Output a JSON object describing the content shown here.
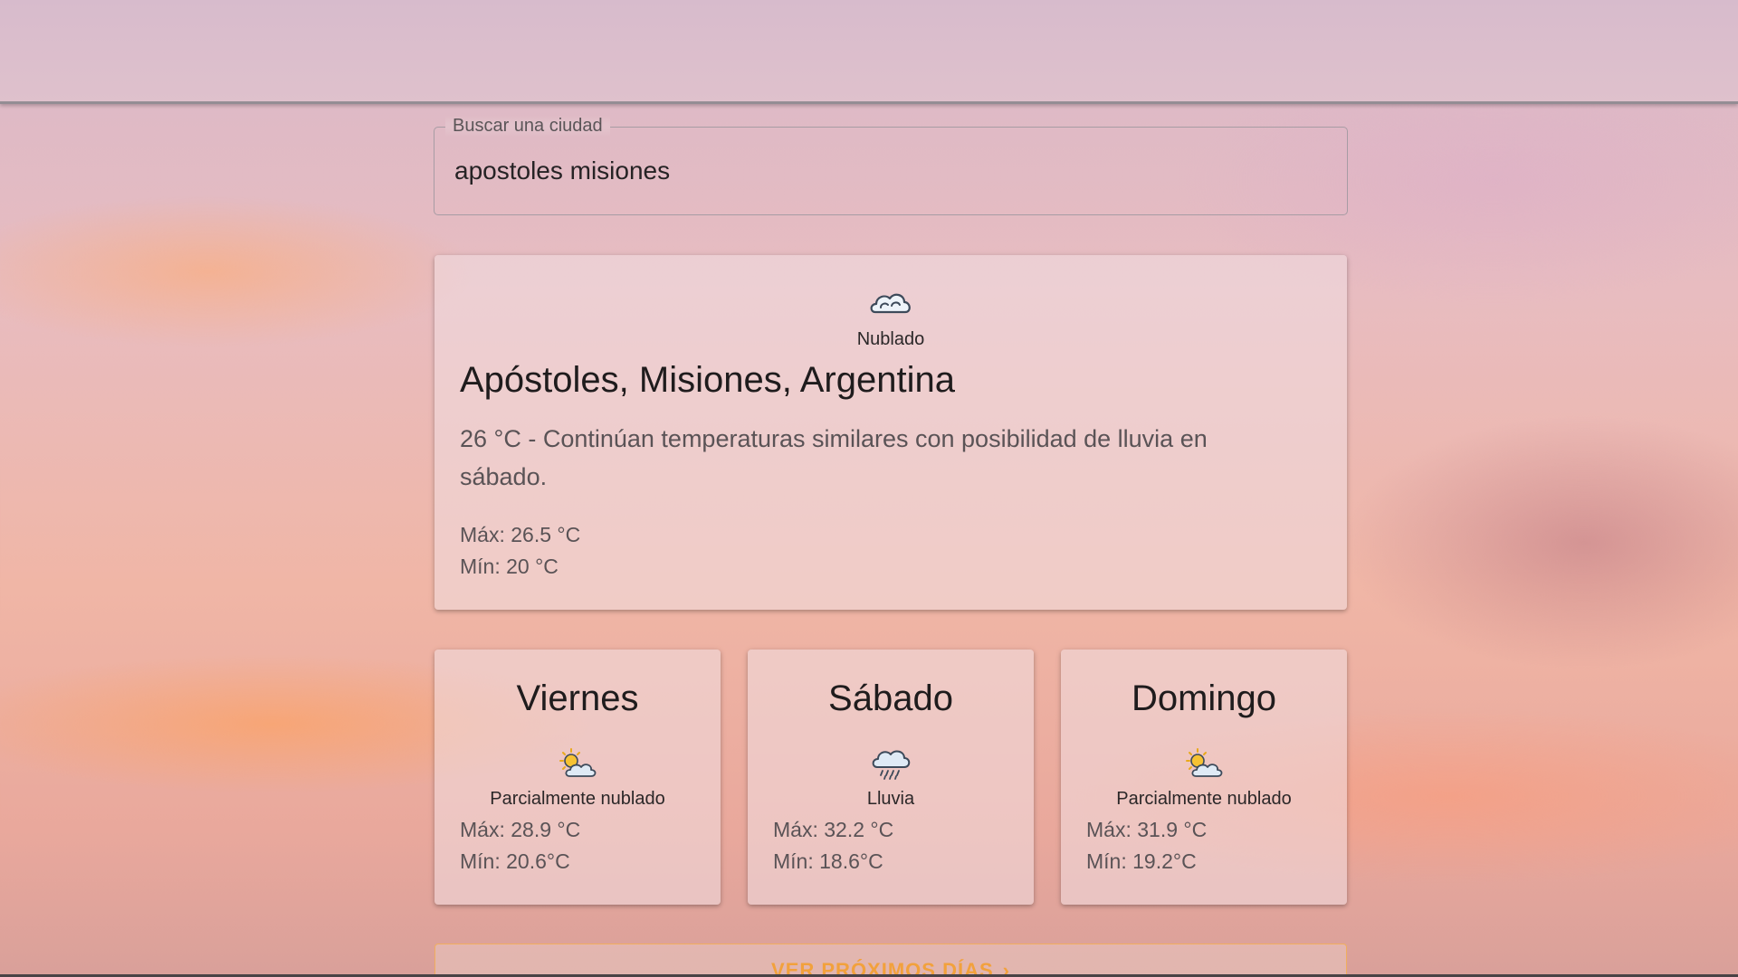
{
  "search": {
    "legend": "Buscar una ciudad",
    "value": "apostoles misiones"
  },
  "current": {
    "condition": "Nublado",
    "condition_icon": "cloud-icon",
    "city": "Apóstoles, Misiones, Argentina",
    "description": "26 °C - Continúan temperaturas similares con posibilidad de lluvia en sábado.",
    "max": "Máx: 26.5 °C",
    "min": "Mín: 20 °C"
  },
  "forecast": [
    {
      "day": "Viernes",
      "condition": "Parcialmente nublado",
      "icon": "partly-cloudy-icon",
      "max": "Máx: 28.9 °C",
      "min": "Mín: 20.6°C"
    },
    {
      "day": "Sábado",
      "condition": "Lluvia",
      "icon": "rain-icon",
      "max": "Máx: 32.2 °C",
      "min": "Mín: 18.6°C"
    },
    {
      "day": "Domingo",
      "condition": "Parcialmente nublado",
      "icon": "partly-cloudy-icon",
      "max": "Máx: 31.9 °C",
      "min": "Mín: 19.2°C"
    }
  ],
  "more_button": {
    "label": "VER PRÓXIMOS DÍAS",
    "icon": "chevron-right-icon",
    "color": "#f2a13c"
  }
}
